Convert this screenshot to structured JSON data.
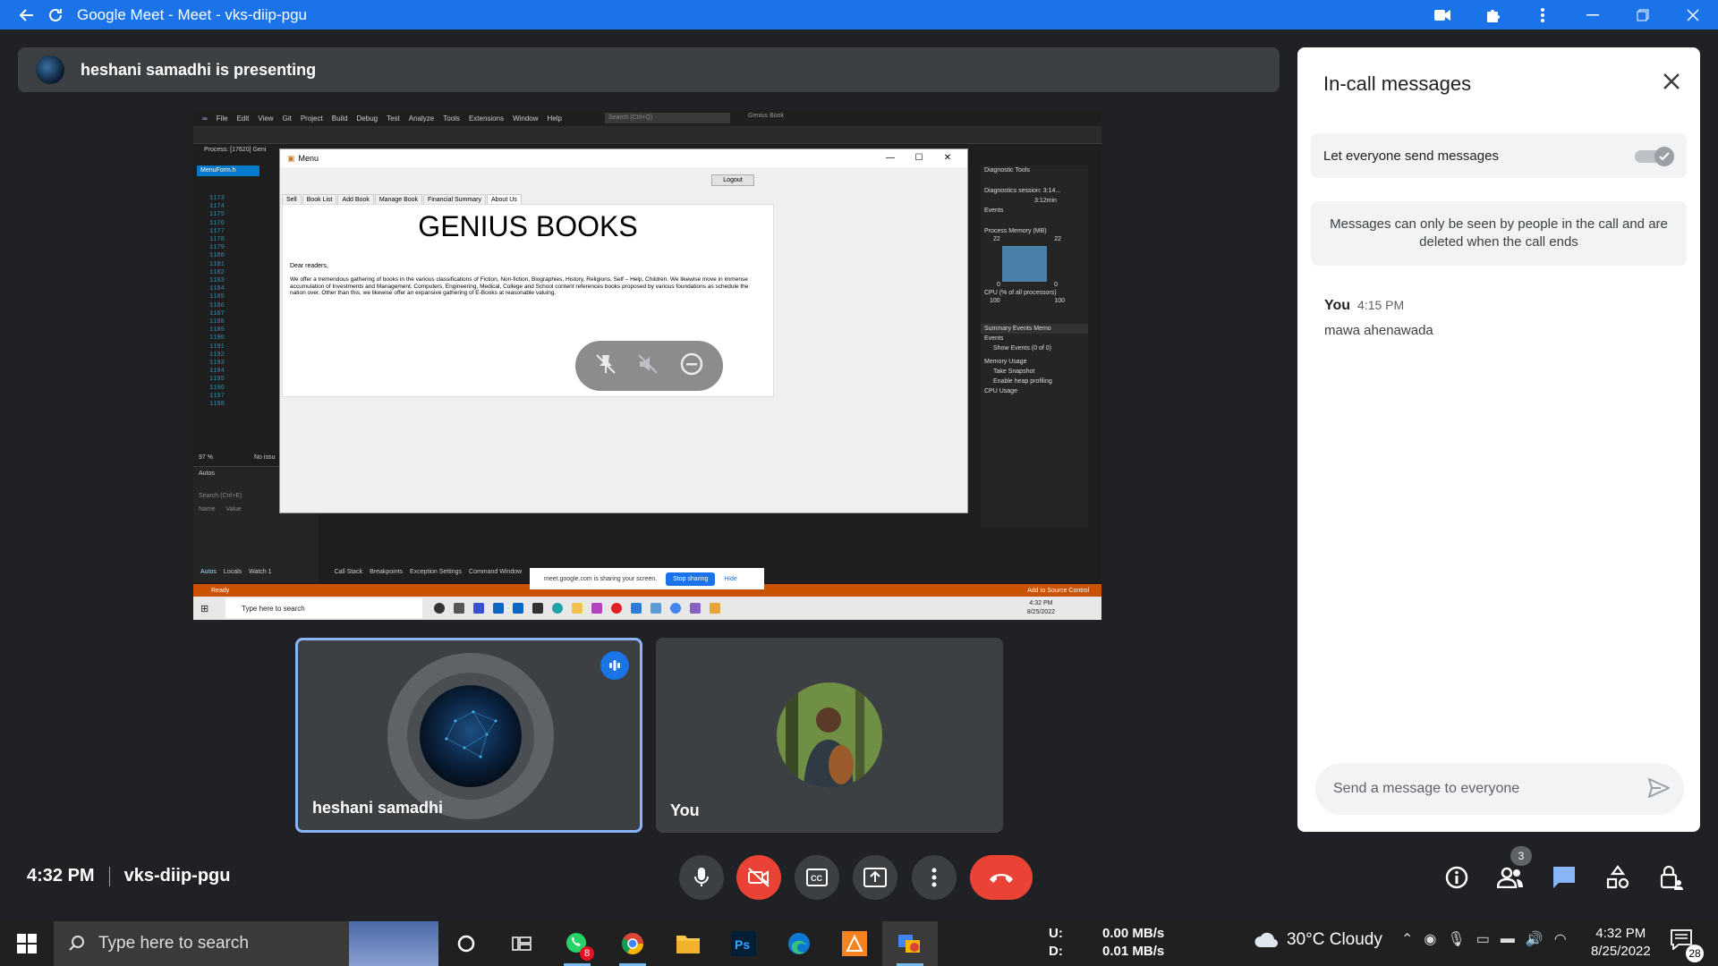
{
  "window": {
    "title": "Google Meet - Meet - vks-diip-pgu"
  },
  "presenting_banner": "heshani samadhi is presenting",
  "shared_screen": {
    "vs_menu": [
      "File",
      "Edit",
      "View",
      "Git",
      "Project",
      "Build",
      "Debug",
      "Test",
      "Analyze",
      "Tools",
      "Extensions",
      "Window",
      "Help"
    ],
    "vs_search": "Search (Ctrl+Q)",
    "vs_solution": "Genius Book",
    "vs_process": "Process: [17620] Geni",
    "vs_tab": "MenuForm.h",
    "vs_line_numbers": "1173\n1174\n1175\n1176\n1177\n1178\n1179\n1180\n1181\n1182\n1183\n1184\n1185\n1186\n1187\n1188\n1189\n1190\n1191\n1192\n1193\n1194\n1195\n1196\n1197\n1198",
    "vs_zoom": "97 %",
    "vs_no_issues": "No issu",
    "autos_title": "Autos",
    "autos_search": "Search (Ctrl+E)",
    "autos_name": "Name",
    "autos_value": "Value",
    "bottom_tabs": [
      "Autos",
      "Locals",
      "Watch 1",
      "Call Stack",
      "Breakpoints",
      "Exception Settings",
      "Command Window"
    ],
    "diag": {
      "title": "Diagnostic Tools",
      "session": "Diagnostics session: 3:14...",
      "timer": "3:12min",
      "events": "Events",
      "process_memory": "Process Memory (MB)",
      "mem_top": "22",
      "mem_bottom": "0",
      "cpu": "CPU (% of all processors)",
      "cpu_top": "100",
      "summary_tabs": "Summary  Events  Memo",
      "events2": "Events",
      "show_events": "Show Events (0 of 0)",
      "memory_usage": "Memory Usage",
      "take_snapshot": "Take Snapshot",
      "heap": "Enable heap profiling",
      "cpu_usage": "CPU Usage"
    },
    "status_ready": "Ready",
    "status_source": "Add to Source Control",
    "inner_search": "Type here to search",
    "inner_time": "4:32 PM",
    "inner_date": "8/25/2022",
    "share_notice": "meet.google.com is sharing your screen.",
    "stop_sharing": "Stop sharing",
    "hide": "Hide"
  },
  "app_window": {
    "title": "Menu",
    "logout": "Logout",
    "tabs": [
      "Sell",
      "Book List",
      "Add Book",
      "Manage Book",
      "Financial Summary",
      "About Us"
    ],
    "heading": "GENIUS BOOKS",
    "greeting": "Dear readers,",
    "body": "We offer a tremendous gathering of books in the various classifications of Fiction, Non-fiction, Biographies, History, Religions, Self – Help, Children. We likewise move in immense accumulation of Investments and Management, Computers, Engineering, Medical, College and School content references books proposed by various foundations as schedule the nation over. Other than this, we likewise offer an expansive gathering of E-Books at reasonable valuing."
  },
  "participants": [
    {
      "name": "heshani samadhi",
      "speaking": true
    },
    {
      "name": "You",
      "speaking": false
    }
  ],
  "meeting": {
    "time": "4:32 PM",
    "code": "vks-diip-pgu"
  },
  "people_count": "3",
  "chat": {
    "title": "In-call messages",
    "toggle_label": "Let everyone send messages",
    "toggle_on": true,
    "info": "Messages can only be seen by people in the call and are deleted when the call ends",
    "messages": [
      {
        "sender": "You",
        "time": "4:15 PM",
        "text": "mawa ahenawada"
      }
    ],
    "input_placeholder": "Send a message to everyone"
  },
  "taskbar": {
    "search_placeholder": "Type here to search",
    "whatsapp_badge": "8",
    "net_up_label": "U:",
    "net_up": "0.00 MB/s",
    "net_down_label": "D:",
    "net_down": "0.01 MB/s",
    "weather": "30°C  Cloudy",
    "time": "4:32 PM",
    "date": "8/25/2022",
    "notifications": "28"
  },
  "colors": {
    "accent": "#1a73e8",
    "end_call": "#ea4335",
    "background": "#202124",
    "tile": "#3c4043"
  }
}
